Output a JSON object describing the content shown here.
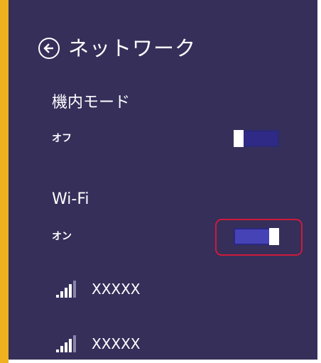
{
  "accent_color": "#f0b11e",
  "panel_color": "#352f5a",
  "highlight_color": "#cc1b3a",
  "header": {
    "back_icon": "back-arrow-circle-icon",
    "title": "ネットワーク"
  },
  "airplane_mode": {
    "label": "機内モード",
    "state": "オフ",
    "on": false
  },
  "wifi": {
    "label": "Wi-Fi",
    "state": "オン",
    "on": true
  },
  "networks": [
    {
      "name": "XXXXX",
      "icon": "wifi-signal-icon"
    },
    {
      "name": "XXXXX",
      "icon": "wifi-signal-icon"
    }
  ]
}
